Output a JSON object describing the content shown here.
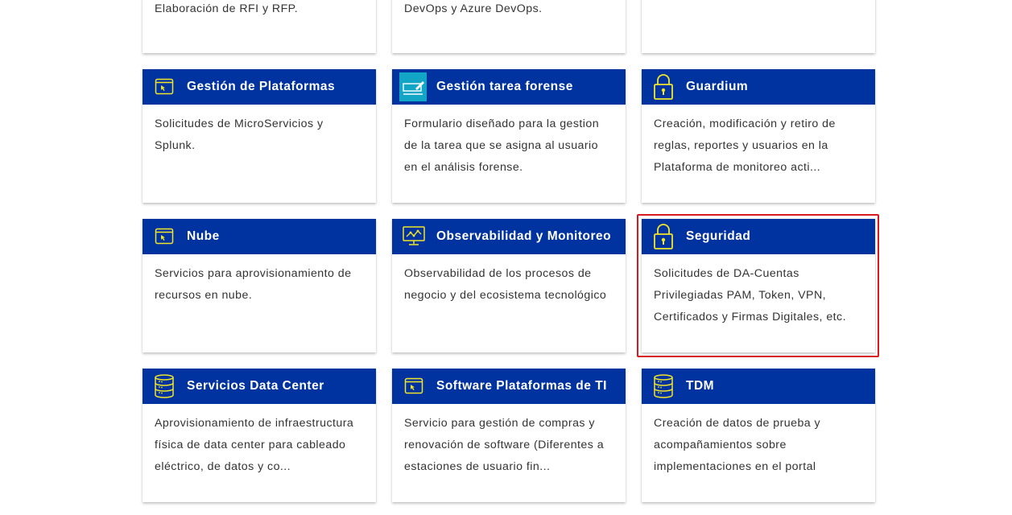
{
  "colors": {
    "header_bg": "#0033a0",
    "icon_yellow": "#f2e529",
    "highlight": "#d71920"
  },
  "top_row": [
    {
      "desc": "Elaboración de RFI y RFP."
    },
    {
      "desc": "DevOps y Azure DevOps."
    },
    {
      "desc": ""
    }
  ],
  "cards": [
    {
      "title": "Gestión de Plataformas",
      "icon": "browser-cursor-icon",
      "desc": "Solicitudes de MicroServicios y Splunk."
    },
    {
      "title": "Gestión tarea forense",
      "icon": "forensic-form-icon",
      "desc": "Formulario diseñado para la gestion de la tarea que se asigna al usuario en el análisis forense."
    },
    {
      "title": "Guardium",
      "icon": "padlock-icon",
      "desc": "Creación, modificación y retiro de reglas, reportes y usuarios en la Plataforma de monitoreo acti..."
    },
    {
      "title": "Nube",
      "icon": "browser-cursor-icon",
      "desc": "Servicios para aprovisionamiento de recursos en nube."
    },
    {
      "title": "Observabilidad y Monitoreo",
      "icon": "monitor-chart-icon",
      "desc": "Observabilidad de los procesos de negocio y del ecosistema tecnológico"
    },
    {
      "title": "Seguridad",
      "icon": "padlock-icon",
      "desc": "Solicitudes de DA-Cuentas Privilegiadas PAM, Token, VPN, Certificados y Firmas Digitales, etc."
    },
    {
      "title": "Servicios Data Center",
      "icon": "database-icon",
      "desc": "Aprovisionamiento de infraestructura física de data center para cableado eléctrico, de datos y co..."
    },
    {
      "title": "Software Plataformas de TI",
      "icon": "browser-cursor-icon",
      "desc": "Servicio para gestión de compras y renovación de software (Diferentes a estaciones de usuario fin..."
    },
    {
      "title": "TDM",
      "icon": "database-icon",
      "desc": "Creación de datos de prueba y acompañamientos sobre implementaciones en el portal"
    }
  ]
}
